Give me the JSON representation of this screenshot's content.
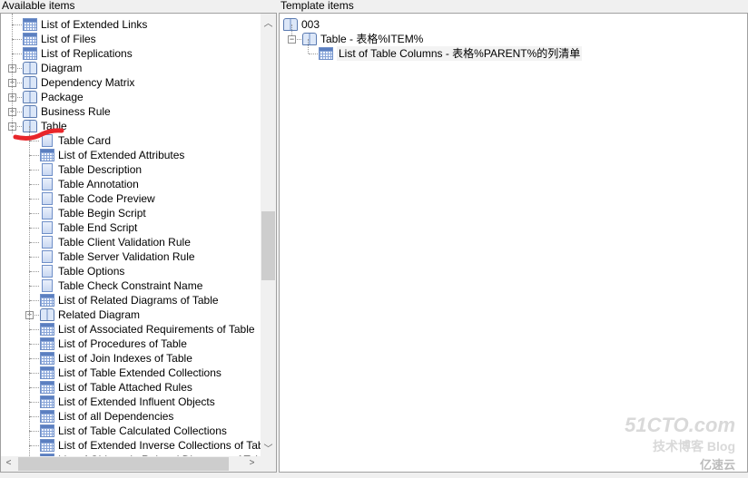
{
  "left_panel": {
    "title": "Available items",
    "items": [
      {
        "label": "List of Extended Links",
        "icon": "grid",
        "level": 1
      },
      {
        "label": "List of Files",
        "icon": "grid",
        "level": 1
      },
      {
        "label": "List of Replications",
        "icon": "grid",
        "level": 1
      },
      {
        "label": "Diagram",
        "icon": "book",
        "level": 1,
        "expander": "+"
      },
      {
        "label": "Dependency Matrix",
        "icon": "book",
        "level": 1,
        "expander": "+"
      },
      {
        "label": "Package",
        "icon": "book",
        "level": 1,
        "expander": "+"
      },
      {
        "label": "Business Rule",
        "icon": "book",
        "level": 1,
        "expander": "+"
      },
      {
        "label": "Table",
        "icon": "book",
        "level": 1,
        "expander": "-"
      },
      {
        "label": "Table Card",
        "icon": "doc",
        "level": 2
      },
      {
        "label": "List of Extended Attributes",
        "icon": "grid",
        "level": 2
      },
      {
        "label": "Table Description",
        "icon": "doc",
        "level": 2
      },
      {
        "label": "Table Annotation",
        "icon": "doc",
        "level": 2
      },
      {
        "label": "Table Code Preview",
        "icon": "doc",
        "level": 2
      },
      {
        "label": "Table Begin Script",
        "icon": "doc",
        "level": 2
      },
      {
        "label": "Table End Script",
        "icon": "doc",
        "level": 2
      },
      {
        "label": "Table Client Validation Rule",
        "icon": "doc",
        "level": 2
      },
      {
        "label": "Table Server Validation Rule",
        "icon": "doc",
        "level": 2
      },
      {
        "label": "Table Options",
        "icon": "doc",
        "level": 2
      },
      {
        "label": "Table Check Constraint Name",
        "icon": "doc",
        "level": 2
      },
      {
        "label": "List of Related Diagrams of Table",
        "icon": "grid",
        "level": 2
      },
      {
        "label": "Related Diagram",
        "icon": "book",
        "level": 2,
        "expander": "+"
      },
      {
        "label": "List of Associated Requirements of Table",
        "icon": "grid",
        "level": 2
      },
      {
        "label": "List of Procedures of Table",
        "icon": "grid",
        "level": 2
      },
      {
        "label": "List of Join Indexes of Table",
        "icon": "grid",
        "level": 2
      },
      {
        "label": "List of Table Extended Collections",
        "icon": "grid",
        "level": 2
      },
      {
        "label": "List of Table Attached Rules",
        "icon": "grid",
        "level": 2
      },
      {
        "label": "List of Extended Influent Objects",
        "icon": "grid",
        "level": 2
      },
      {
        "label": "List of all Dependencies",
        "icon": "grid",
        "level": 2
      },
      {
        "label": "List of Table Calculated Collections",
        "icon": "grid",
        "level": 2
      },
      {
        "label": "List of Extended Inverse Collections of Table",
        "icon": "grid",
        "level": 2
      },
      {
        "label": "List of Objects in Related Diagrams of Table",
        "icon": "grid",
        "level": 2
      }
    ]
  },
  "right_panel": {
    "title": "Template items",
    "items": [
      {
        "label": "003",
        "icon": "book",
        "level": 0
      },
      {
        "label": "Table - 表格%ITEM%",
        "icon": "book",
        "level": 1,
        "expander": "-"
      },
      {
        "label": "List of Table Columns - 表格%PARENT%的列清单",
        "icon": "grid",
        "level": 2
      }
    ]
  },
  "watermark": {
    "line1": "51CTO.com",
    "line2": "技术博客  Blog",
    "line3": "亿速云"
  },
  "annotation_color": "#e8262b"
}
